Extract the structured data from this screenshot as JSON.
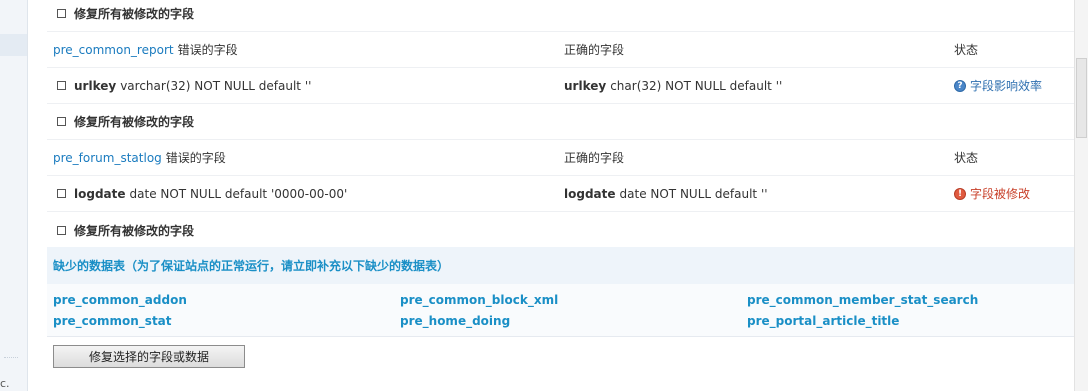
{
  "fix_all_label": "修复所有被修改的字段",
  "tables": [
    {
      "table_name": "pre_common_report",
      "wrong_label": "错误的字段",
      "correct_label": "正确的字段",
      "status_header": "状态",
      "field": {
        "wrong_name": "urlkey",
        "wrong_def": "varchar(32) NOT NULL default ''",
        "correct_name": "urlkey",
        "correct_def": "char(32) NOT NULL default ''",
        "status_text": "字段影响效率",
        "status_icon": "info-icon",
        "status_color": "#2f70b0"
      }
    },
    {
      "table_name": "pre_forum_statlog",
      "wrong_label": "错误的字段",
      "correct_label": "正确的字段",
      "status_header": "状态",
      "field": {
        "wrong_name": "logdate",
        "wrong_def": "date NOT NULL default '0000-00-00'",
        "correct_name": "logdate",
        "correct_def": "date NOT NULL default ''",
        "status_text": "字段被修改",
        "status_icon": "warning-icon",
        "status_color": "#c8402a"
      }
    }
  ],
  "missing": {
    "header": "缺少的数据表（为了保证站点的正常运行，请立即补充以下缺少的数据表）",
    "tables": [
      "pre_common_addon",
      "pre_common_block_xml",
      "pre_common_member_stat_search",
      "pre_common_stat",
      "pre_home_doing",
      "pre_portal_article_title"
    ]
  },
  "submit_label": "修复选择的字段或数据",
  "sidebar_fragment": "c.",
  "colors": {
    "link": "#1a7bbf",
    "missing_table": "#1a8fc6",
    "header_bg": "#eef4fa"
  }
}
